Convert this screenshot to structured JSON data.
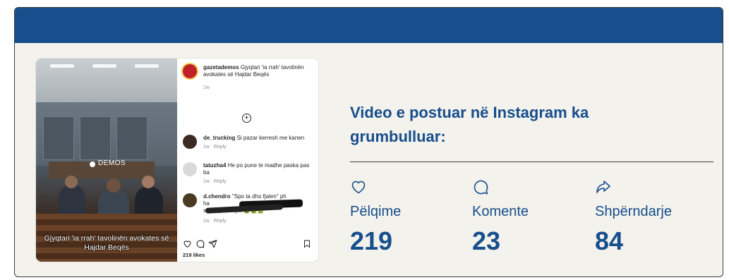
{
  "colors": {
    "brand": "#174e8c",
    "card_bg": "#f3f2ec"
  },
  "post": {
    "video_logo": "DEMOS",
    "video_caption": "Gjyqtari 'ia rrah' tavolinën avokates së Hajdar Beqës",
    "author": {
      "username": "gazetademos",
      "text": "Gjyqtari 'ia rrah' tavolinën avokates së Hajdar Beqës",
      "time": "1w"
    },
    "comments": [
      {
        "username": "de_trucking",
        "text": "Si pazar kerresh me kanen",
        "time": "1w",
        "reply": "Reply"
      },
      {
        "username": "tatuzha4",
        "text": "He po pune te madhe paska pas ba",
        "time": "1w",
        "reply": "Reply"
      },
      {
        "username": "d.chendro",
        "text": "\"Spo ta dho fjalen\" ph",
        "text2": "ha",
        "text3": "shtet qe 25 vjet 🤮🤮🤮",
        "time": "1w",
        "reply": "Reply"
      }
    ],
    "likes": "219 likes"
  },
  "headline": "Video e postuar në Instagram ka grumbulluar:",
  "stats": [
    {
      "icon": "heart-icon",
      "label": "Pëlqime",
      "value": "219"
    },
    {
      "icon": "comment-icon",
      "label": "Komente",
      "value": "23"
    },
    {
      "icon": "share-icon",
      "label": "Shpërndarje",
      "value": "84"
    }
  ]
}
